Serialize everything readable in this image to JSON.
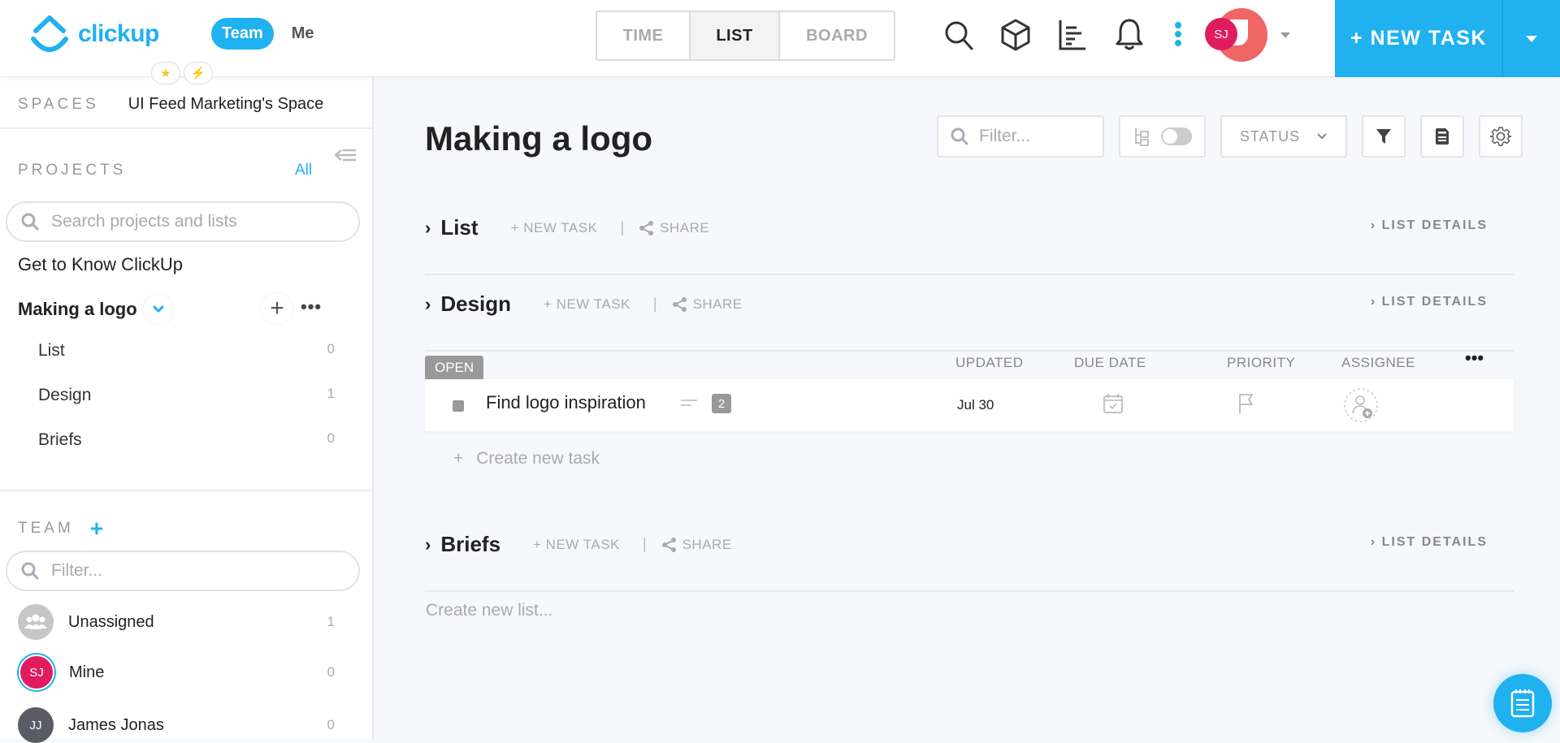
{
  "app": {
    "brand": "clickup",
    "accent": "#1fb1f0"
  },
  "header": {
    "scope": {
      "team_label": "Team",
      "me_label": "Me",
      "active": "Team"
    },
    "favorites": [
      {
        "icon": "star-icon",
        "glyph": "★"
      },
      {
        "icon": "lightning-icon",
        "glyph": "⚡"
      }
    ],
    "views": [
      {
        "label": "TIME",
        "active": false
      },
      {
        "label": "LIST",
        "active": true
      },
      {
        "label": "BOARD",
        "active": false
      }
    ],
    "icons": [
      "search-icon",
      "box-icon",
      "dashboard-icon",
      "bell-icon",
      "more-vertical-icon"
    ],
    "user": {
      "initials": "SJ"
    },
    "new_task_label": "+ NEW TASK"
  },
  "sidebar": {
    "spaces_label": "SPACES",
    "space_name": "UI Feed Marketing's Space",
    "projects_label": "PROJECTS",
    "projects_all": "All",
    "search_placeholder": "Search projects and lists",
    "projects": [
      {
        "name": "Get to Know ClickUp"
      }
    ],
    "active_project": {
      "name": "Making a logo",
      "lists": [
        {
          "name": "List",
          "count": "0"
        },
        {
          "name": "Design",
          "count": "1"
        },
        {
          "name": "Briefs",
          "count": "0"
        }
      ]
    },
    "team_label": "TEAM",
    "team_filter_placeholder": "Filter...",
    "members": [
      {
        "name": "Unassigned",
        "initials": "",
        "count": "1",
        "color": "#c6c6c8"
      },
      {
        "name": "Mine",
        "initials": "SJ",
        "count": "0",
        "color": "#e01b60"
      },
      {
        "name": "James Jonas",
        "initials": "JJ",
        "count": "0",
        "color": "#5b5b66"
      }
    ]
  },
  "main": {
    "title": "Making a logo",
    "toolbar": {
      "filter_placeholder": "Filter...",
      "status_label": "STATUS"
    },
    "lists": [
      {
        "name": "List",
        "new_task": "+ NEW TASK",
        "share": "SHARE",
        "details": "LIST DETAILS"
      },
      {
        "name": "Design",
        "new_task": "+ NEW TASK",
        "share": "SHARE",
        "details": "LIST DETAILS"
      },
      {
        "name": "Briefs",
        "new_task": "+ NEW TASK",
        "share": "SHARE",
        "details": "LIST DETAILS"
      }
    ],
    "group": {
      "status": "OPEN",
      "columns": {
        "updated": "UPDATED",
        "due_date": "DUE DATE",
        "priority": "PRIORITY",
        "assignee": "ASSIGNEE"
      },
      "tasks": [
        {
          "name": "Find logo inspiration",
          "subtasks": "2",
          "updated": "Jul 30"
        }
      ],
      "create_task": "Create new task",
      "create_plus": "+"
    },
    "create_list": "Create new list..."
  }
}
